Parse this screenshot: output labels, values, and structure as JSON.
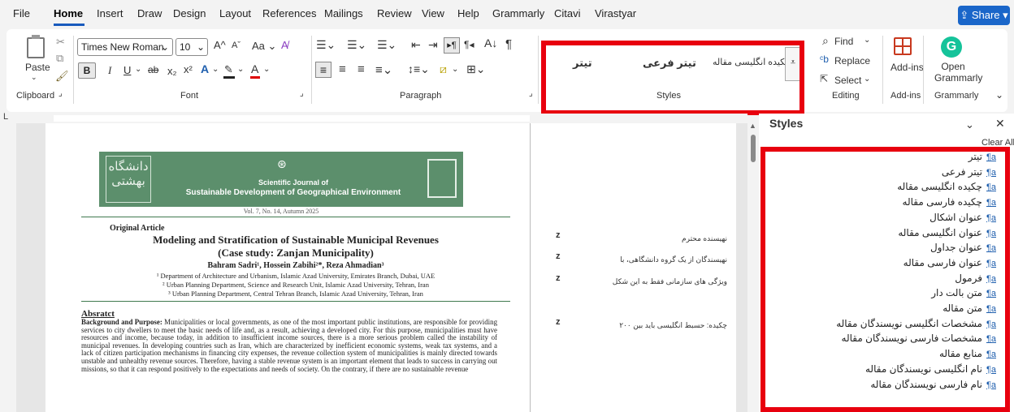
{
  "menubar": {
    "tabs": [
      "File",
      "Home",
      "Insert",
      "Draw",
      "Design",
      "Layout",
      "References",
      "Mailings",
      "Review",
      "View",
      "Help",
      "Grammarly",
      "Citavi",
      "Virastyar"
    ],
    "active": "Home",
    "share_label": "Share"
  },
  "ribbon": {
    "paste_label": "Paste",
    "font": {
      "name": "Times New Roman",
      "size": "10"
    },
    "styles": [
      "تیتر",
      "تیتر فرعی",
      "چکیده انگلیسی مقاله"
    ],
    "find_label": "Find",
    "replace_label": "Replace",
    "select_label": "Select",
    "addins_label": "Add-ins",
    "grammarly_label": "Open Grammarly",
    "groups": {
      "clipboard": "Clipboard",
      "font": "Font",
      "paragraph": "Paragraph",
      "styles": "Styles",
      "editing": "Editing",
      "addins": "Add-ins",
      "grammarly": "Grammarly"
    }
  },
  "styles_pane": {
    "title": "Styles",
    "clear_all": "Clear All",
    "items": [
      "تیتر",
      "تیتر فرعی",
      "چکیده انگلیسی مقاله",
      "چکیده فارسی مقاله",
      "عنوان اشکال",
      "عنوان انگلیسی مقاله",
      "عنوان جداول",
      "عنوان فارسی مقاله",
      "فرمول",
      "متن بالت دار",
      "متن مقاله",
      "مشخصات انگلیسی نویسندگان مقاله",
      "مشخصات فارسی نویسندگان مقاله",
      "منابع مقاله",
      "نام انگلیسی نویسندگان مقاله",
      "نام فارسی نویسندگان مقاله"
    ],
    "item_icon": "¶a"
  },
  "document": {
    "journal_line1": "Scientific Journal of",
    "journal_line2": "Sustainable Development of Geographical Environment",
    "volume": "Vol. 7, No. 14, Autumn 2025",
    "article_type": "Original Article",
    "title1": "Modeling and Stratification of Sustainable Municipal Revenues",
    "title2": "(Case study: Zanjan Municipality)",
    "authors": "Bahram Sadri¹, Hossein Zabihi²*, Reza Ahmadian³",
    "aff1": "¹ Department of Architecture and Urbanism, Islamic Azad University, Emirates Branch, Dubai, UAE",
    "aff2": "² Urban Planning Department, Science and Research Unit, Islamic Azad University, Tehran, Iran",
    "aff3": "³ Urban Planning Department, Central Tehran Branch, Islamic Azad University, Tehran, Iran",
    "abstract_heading": "Absratct",
    "abstract_lead": "Background and Purpose:",
    "abstract_text": "Municipalities or local governments, as one of the most important public institutions, are responsible for providing services to city dwellers to meet the basic needs of life and, as a result, achieving a developed city. For this purpose, municipalities must have resources and income, because today, in addition to insufficient income sources, there is a more serious problem called the instability of municipal revenues. In developing countries such as Iran, which are characterized by inefficient economic systems, weak tax systems, and a lack of citizen participation mechanisms in financing city expenses, the revenue collection system of municipalities is mainly directed towards unstable and unhealthy revenue sources. Therefore, having a stable revenue system is an important element that leads to success in carrying out missions, so that it can respond positively to the expectations and needs of society. On the contrary, if there are no sustainable revenue",
    "side_notes": [
      {
        "z": "z",
        "text": "نهیسنده محترم"
      },
      {
        "z": "z",
        "text": "نهیسندگان از یک گروه دانشگاهی، با"
      },
      {
        "z": "z",
        "text": "ویژگی های سازمانی فقط به این شکل"
      },
      {
        "z": "z",
        "text": "چکیده: حسبط انگلیسی باید بین ۲۰۰"
      }
    ]
  },
  "colors": {
    "accent": "#185abd",
    "highlight": "#e8000e",
    "share_bg": "#1a66c9",
    "grammarly": "#15c39a",
    "banner": "#5c8f6c",
    "style_link": "#1f5fae"
  }
}
